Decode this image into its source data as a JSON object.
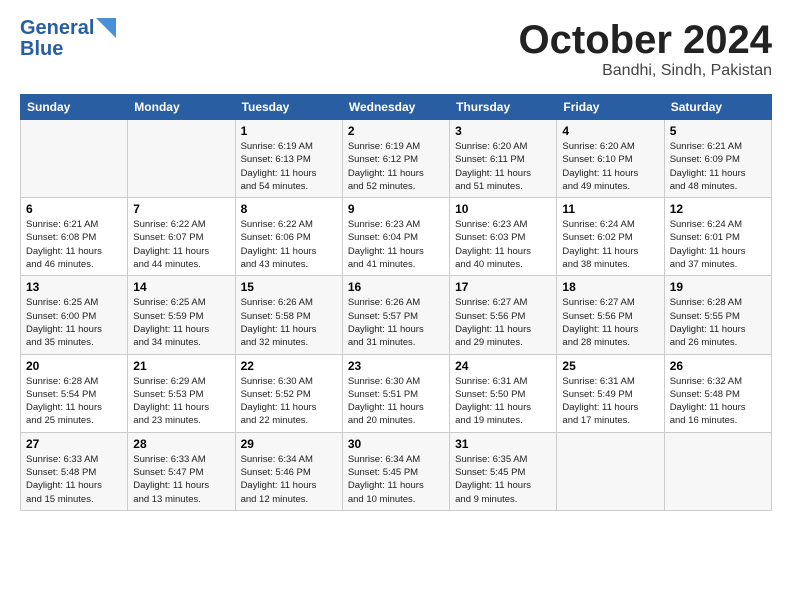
{
  "header": {
    "logo": {
      "line1": "General",
      "line2": "Blue"
    },
    "title": "October 2024",
    "subtitle": "Bandhi, Sindh, Pakistan"
  },
  "weekdays": [
    "Sunday",
    "Monday",
    "Tuesday",
    "Wednesday",
    "Thursday",
    "Friday",
    "Saturday"
  ],
  "weeks": [
    [
      {
        "day": "",
        "info": ""
      },
      {
        "day": "",
        "info": ""
      },
      {
        "day": "1",
        "info": "Sunrise: 6:19 AM\nSunset: 6:13 PM\nDaylight: 11 hours\nand 54 minutes."
      },
      {
        "day": "2",
        "info": "Sunrise: 6:19 AM\nSunset: 6:12 PM\nDaylight: 11 hours\nand 52 minutes."
      },
      {
        "day": "3",
        "info": "Sunrise: 6:20 AM\nSunset: 6:11 PM\nDaylight: 11 hours\nand 51 minutes."
      },
      {
        "day": "4",
        "info": "Sunrise: 6:20 AM\nSunset: 6:10 PM\nDaylight: 11 hours\nand 49 minutes."
      },
      {
        "day": "5",
        "info": "Sunrise: 6:21 AM\nSunset: 6:09 PM\nDaylight: 11 hours\nand 48 minutes."
      }
    ],
    [
      {
        "day": "6",
        "info": "Sunrise: 6:21 AM\nSunset: 6:08 PM\nDaylight: 11 hours\nand 46 minutes."
      },
      {
        "day": "7",
        "info": "Sunrise: 6:22 AM\nSunset: 6:07 PM\nDaylight: 11 hours\nand 44 minutes."
      },
      {
        "day": "8",
        "info": "Sunrise: 6:22 AM\nSunset: 6:06 PM\nDaylight: 11 hours\nand 43 minutes."
      },
      {
        "day": "9",
        "info": "Sunrise: 6:23 AM\nSunset: 6:04 PM\nDaylight: 11 hours\nand 41 minutes."
      },
      {
        "day": "10",
        "info": "Sunrise: 6:23 AM\nSunset: 6:03 PM\nDaylight: 11 hours\nand 40 minutes."
      },
      {
        "day": "11",
        "info": "Sunrise: 6:24 AM\nSunset: 6:02 PM\nDaylight: 11 hours\nand 38 minutes."
      },
      {
        "day": "12",
        "info": "Sunrise: 6:24 AM\nSunset: 6:01 PM\nDaylight: 11 hours\nand 37 minutes."
      }
    ],
    [
      {
        "day": "13",
        "info": "Sunrise: 6:25 AM\nSunset: 6:00 PM\nDaylight: 11 hours\nand 35 minutes."
      },
      {
        "day": "14",
        "info": "Sunrise: 6:25 AM\nSunset: 5:59 PM\nDaylight: 11 hours\nand 34 minutes."
      },
      {
        "day": "15",
        "info": "Sunrise: 6:26 AM\nSunset: 5:58 PM\nDaylight: 11 hours\nand 32 minutes."
      },
      {
        "day": "16",
        "info": "Sunrise: 6:26 AM\nSunset: 5:57 PM\nDaylight: 11 hours\nand 31 minutes."
      },
      {
        "day": "17",
        "info": "Sunrise: 6:27 AM\nSunset: 5:56 PM\nDaylight: 11 hours\nand 29 minutes."
      },
      {
        "day": "18",
        "info": "Sunrise: 6:27 AM\nSunset: 5:56 PM\nDaylight: 11 hours\nand 28 minutes."
      },
      {
        "day": "19",
        "info": "Sunrise: 6:28 AM\nSunset: 5:55 PM\nDaylight: 11 hours\nand 26 minutes."
      }
    ],
    [
      {
        "day": "20",
        "info": "Sunrise: 6:28 AM\nSunset: 5:54 PM\nDaylight: 11 hours\nand 25 minutes."
      },
      {
        "day": "21",
        "info": "Sunrise: 6:29 AM\nSunset: 5:53 PM\nDaylight: 11 hours\nand 23 minutes."
      },
      {
        "day": "22",
        "info": "Sunrise: 6:30 AM\nSunset: 5:52 PM\nDaylight: 11 hours\nand 22 minutes."
      },
      {
        "day": "23",
        "info": "Sunrise: 6:30 AM\nSunset: 5:51 PM\nDaylight: 11 hours\nand 20 minutes."
      },
      {
        "day": "24",
        "info": "Sunrise: 6:31 AM\nSunset: 5:50 PM\nDaylight: 11 hours\nand 19 minutes."
      },
      {
        "day": "25",
        "info": "Sunrise: 6:31 AM\nSunset: 5:49 PM\nDaylight: 11 hours\nand 17 minutes."
      },
      {
        "day": "26",
        "info": "Sunrise: 6:32 AM\nSunset: 5:48 PM\nDaylight: 11 hours\nand 16 minutes."
      }
    ],
    [
      {
        "day": "27",
        "info": "Sunrise: 6:33 AM\nSunset: 5:48 PM\nDaylight: 11 hours\nand 15 minutes."
      },
      {
        "day": "28",
        "info": "Sunrise: 6:33 AM\nSunset: 5:47 PM\nDaylight: 11 hours\nand 13 minutes."
      },
      {
        "day": "29",
        "info": "Sunrise: 6:34 AM\nSunset: 5:46 PM\nDaylight: 11 hours\nand 12 minutes."
      },
      {
        "day": "30",
        "info": "Sunrise: 6:34 AM\nSunset: 5:45 PM\nDaylight: 11 hours\nand 10 minutes."
      },
      {
        "day": "31",
        "info": "Sunrise: 6:35 AM\nSunset: 5:45 PM\nDaylight: 11 hours\nand 9 minutes."
      },
      {
        "day": "",
        "info": ""
      },
      {
        "day": "",
        "info": ""
      }
    ]
  ]
}
